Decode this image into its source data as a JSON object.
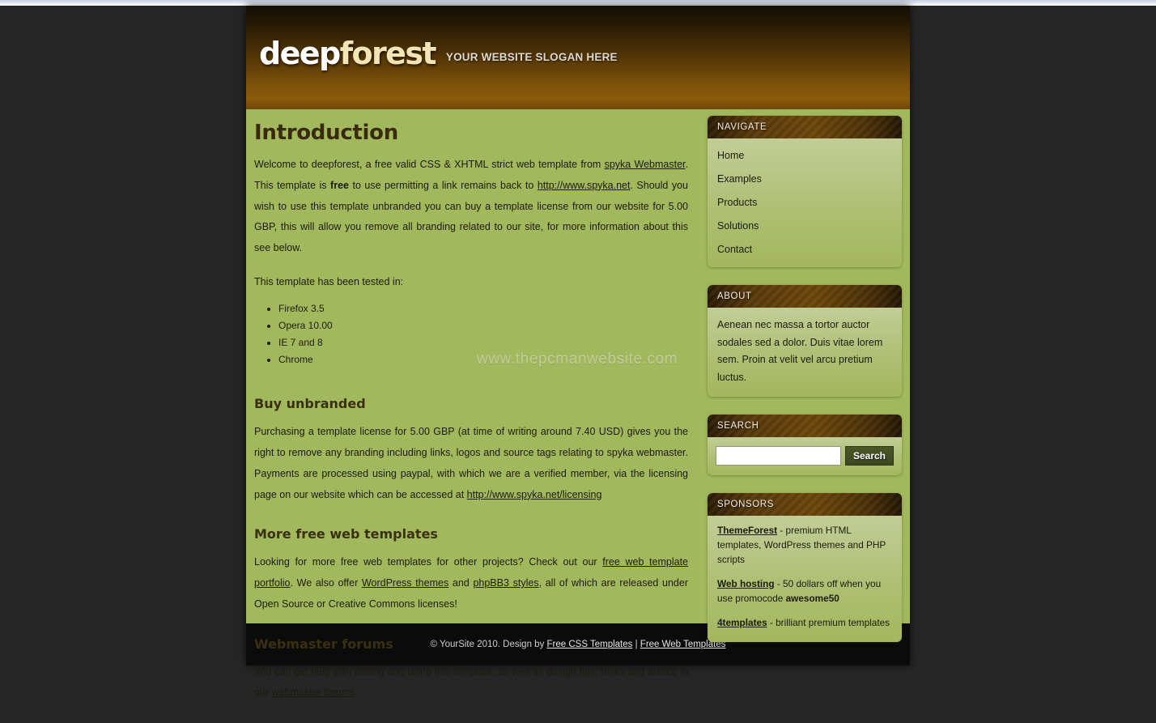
{
  "header": {
    "logo_part1": "deep",
    "logo_part2": "forest",
    "slogan": "YOUR WEBSITE SLOGAN HERE"
  },
  "watermark": "www.thepcmanwebsite.com",
  "content": {
    "title": "Introduction",
    "intro_1": "Welcome to deepforest, a free valid CSS & XHTML strict web template from ",
    "intro_link_1": "spyka Webmaster",
    "intro_2": ". This template is ",
    "intro_bold": "free",
    "intro_3": " to use permitting a link remains back to ",
    "intro_link_2": "http://www.spyka.net",
    "intro_4": ". Should you wish to use this template unbranded you can buy a template license from our website for 5.00 GBP, this will allow you remove all branding related to our site, for more information about this see below.",
    "tested_intro": "This template has been tested in:",
    "browsers": [
      "Firefox 3.5",
      "Opera 10.00",
      "IE 7 and 8",
      "Chrome"
    ],
    "buy_title": "Buy unbranded",
    "buy_text_1": "Purchasing a template license for 5.00 GBP (at time of writing around 7.40 USD) gives you the right to remove any branding including links, logos and source tags relating to spyka webmaster. Payments are processed using paypal, with which we are a verified member, via the licensing page on our website which can be accessed at ",
    "buy_link": "http://www.spyka.net/licensing",
    "more_title": "More free web templates",
    "more_text_1": "Looking for more free web templates for other projects? Check out our ",
    "more_link_1": "free web template portfolio",
    "more_text_2": ". We also offer ",
    "more_link_2": "WordPress themes",
    "more_text_3": " and ",
    "more_link_3": "phpBB3 styles",
    "more_text_4": ", all of which are released under Open Source or Creative Commons licenses!",
    "forums_title": "Webmaster forums",
    "forums_text_1": "You can get help with editing and using this template, as well as design tips, tricks and advice in our ",
    "forums_link": "webmaster forums"
  },
  "sidebar": {
    "navigate": {
      "heading": "NAVIGATE",
      "items": [
        {
          "label": "Home"
        },
        {
          "label": "Examples"
        },
        {
          "label": "Products"
        },
        {
          "label": "Solutions"
        },
        {
          "label": "Contact"
        }
      ]
    },
    "about": {
      "heading": "ABOUT",
      "text": "Aenean nec massa a tortor auctor sodales sed a dolor. Duis vitae lorem sem. Proin at velit vel arcu pretium luctus."
    },
    "search": {
      "heading": "SEARCH",
      "input_value": "",
      "input_placeholder": "",
      "button_label": "Search"
    },
    "sponsors": {
      "heading": "SPONSORS",
      "items": [
        {
          "link": "ThemeForest",
          "text": " - premium HTML templates, WordPress themes and PHP scripts"
        },
        {
          "link": "Web hosting",
          "text_before": " - 50 dollars off when you use promocode ",
          "bold": "awesome50"
        },
        {
          "link": "4templates",
          "text": " - brilliant premium templates"
        }
      ]
    }
  },
  "footer": {
    "copyright": "© YourSite 2010. Design by ",
    "link_1": "Free CSS Templates",
    "separator": " | ",
    "link_2": "Free Web Templates"
  },
  "colors": {
    "content_green": "#a2b85c",
    "header_brown": "#8a5a0a",
    "box_head_brown": "#4a3008",
    "footer_black": "#0b0b0b",
    "page_background": "#262626"
  }
}
